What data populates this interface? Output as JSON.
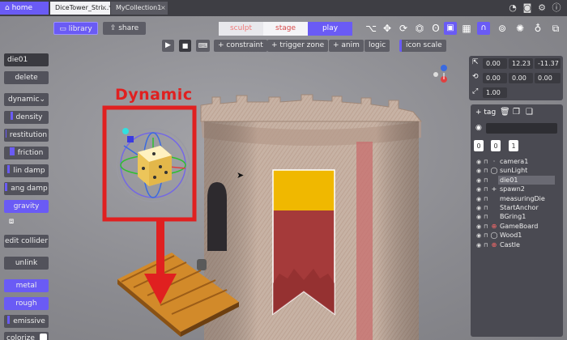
{
  "tabs": {
    "home": "home",
    "open": [
      "DiceTower_Stri...*",
      "MyCollection1"
    ]
  },
  "toolbar": {
    "library": "library",
    "share": "share",
    "modes": [
      "sculpt",
      "stage",
      "play"
    ],
    "active_mode": "play",
    "controls": [
      "+ constraint",
      "+ trigger zone",
      "+ anim",
      "logic",
      "icon scale"
    ]
  },
  "sidebar": {
    "object_name": "die01",
    "delete": "delete",
    "body_type": "dynamic",
    "items": [
      "density",
      "restitution",
      "friction",
      "lin damp",
      "ang damp",
      "gravity"
    ],
    "edit_collider": "edit collider",
    "unlink": "unlink",
    "materials": [
      "metal",
      "rough",
      "emissive",
      "colorize"
    ]
  },
  "annotation": {
    "label": "Dynamic"
  },
  "transform": {
    "position": [
      "0.00",
      "12.23",
      "-11.37"
    ],
    "rotation": [
      "0.00",
      "0.00",
      "0.00"
    ],
    "scale": [
      "1.00"
    ]
  },
  "outliner": {
    "tag_label": "+ tag",
    "tag_slots": [
      "0",
      "0",
      "1"
    ],
    "items": [
      {
        "name": "camera1",
        "icon": "dot-icon"
      },
      {
        "name": "sunLight",
        "icon": "circle-icon"
      },
      {
        "name": "die01",
        "icon": "none",
        "selected": true
      },
      {
        "name": "spawn2",
        "icon": "plus-icon"
      },
      {
        "name": "measuringDie",
        "icon": "none"
      },
      {
        "name": "StartAnchor",
        "icon": "none"
      },
      {
        "name": "BGring1",
        "icon": "none"
      },
      {
        "name": "GameBoard",
        "icon": "plus-circle-icon"
      },
      {
        "name": "Wood1",
        "icon": "circle-icon"
      },
      {
        "name": "Castle",
        "icon": "plus-circle-icon"
      }
    ]
  },
  "colors": {
    "accent": "#6a5bf5",
    "annotation_red": "#e02020",
    "banner_yellow": "#f0b800",
    "banner_red": "#a53a3a"
  }
}
